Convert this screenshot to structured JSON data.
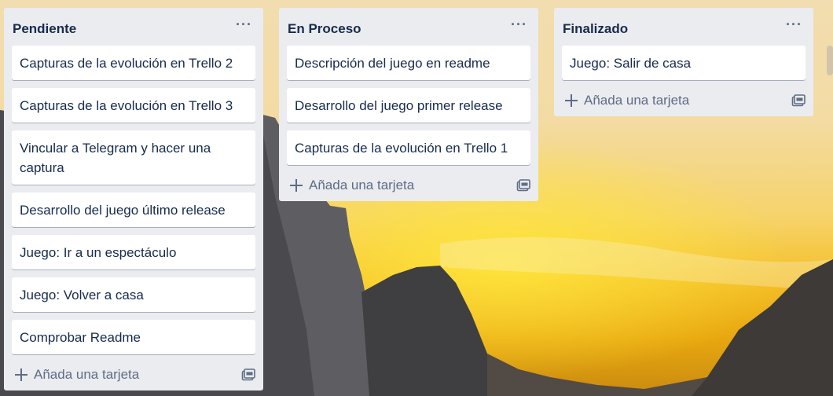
{
  "lists": [
    {
      "title": "Pendiente",
      "menu_label": "···",
      "cards": [
        "Capturas de la evolución en Trello 2",
        "Capturas de la evolución en Trello 3",
        "Vincular a Telegram y hacer una captura",
        "Desarrollo del juego último release",
        "Juego: Ir a un espectáculo",
        "Juego: Volver a casa",
        "Comprobar Readme"
      ],
      "add_card_label": "Añada una tarjeta",
      "template_icon": "card-template-icon"
    },
    {
      "title": "En Proceso",
      "menu_label": "···",
      "cards": [
        "Descripción del juego en readme",
        "Desarrollo del juego primer release",
        "Capturas de la evolución en Trello 1"
      ],
      "add_card_label": "Añada una tarjeta",
      "template_icon": "card-template-icon"
    },
    {
      "title": "Finalizado",
      "menu_label": "···",
      "cards": [
        "Juego: Salir de casa"
      ],
      "add_card_label": "Añada una tarjeta",
      "template_icon": "card-template-icon"
    }
  ],
  "colors": {
    "list_bg": "#ebecf0",
    "card_bg": "#ffffff",
    "text": "#172b4d",
    "muted": "#5e6c84"
  }
}
